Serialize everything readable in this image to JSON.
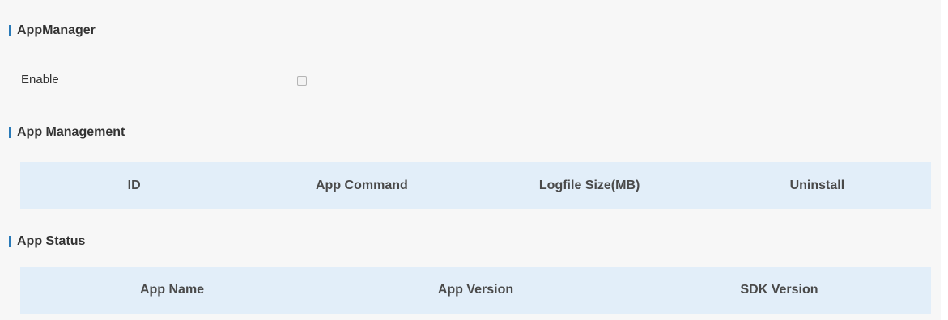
{
  "appmanager": {
    "title": "AppManager",
    "enable_label": "Enable",
    "enable_checked": false
  },
  "app_management": {
    "title": "App Management",
    "columns": [
      "ID",
      "App Command",
      "Logfile Size(MB)",
      "Uninstall"
    ]
  },
  "app_status": {
    "title": "App Status",
    "columns": [
      "App Name",
      "App Version",
      "SDK Version"
    ]
  },
  "colors": {
    "accent_bar": "#2a7ab8",
    "table_header_bg": "#e2eef9",
    "panel_bg": "#f7f7f7"
  }
}
